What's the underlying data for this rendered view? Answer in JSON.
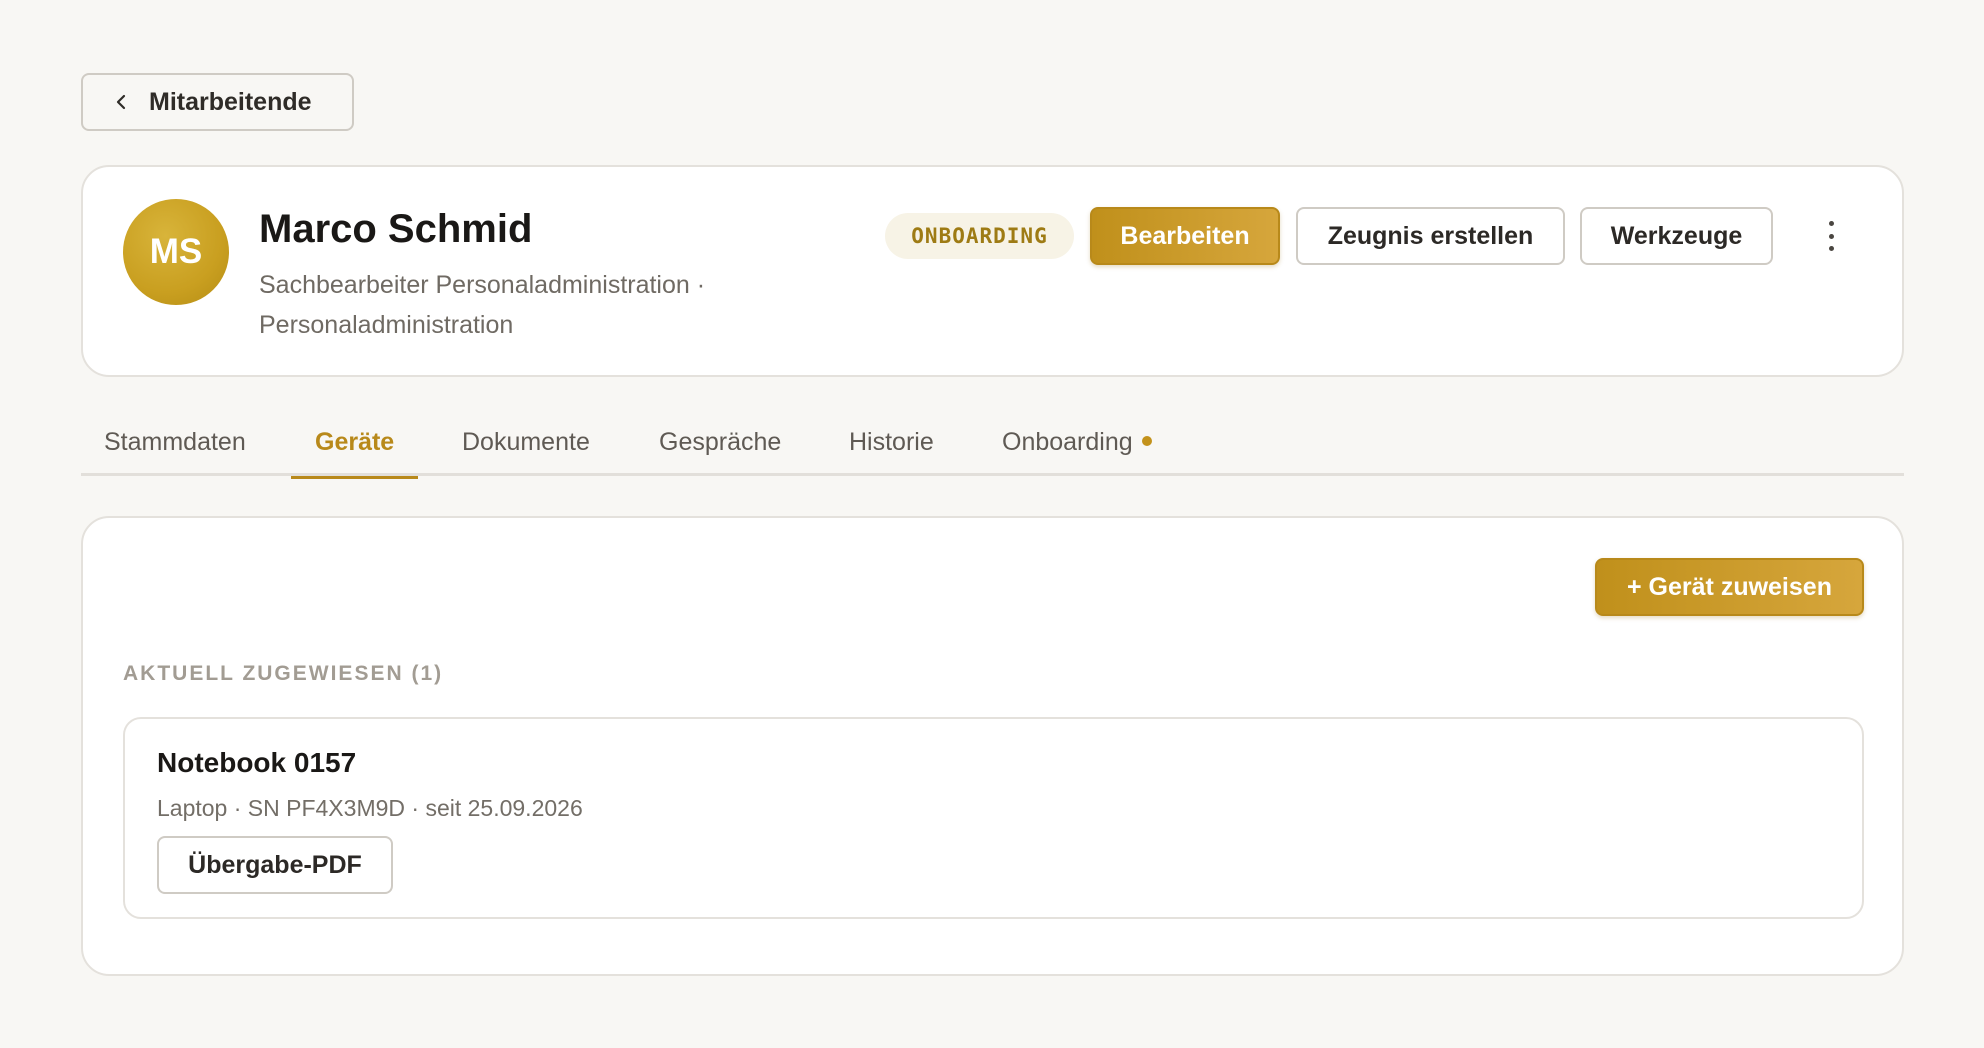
{
  "nav": {
    "back_label": "Mitarbeitende"
  },
  "employee": {
    "initials": "MS",
    "name": "Marco Schmid",
    "subtitle": "Sachbearbeiter Personaladministration · Personaladministration",
    "status_badge": "ONBOARDING"
  },
  "actions": {
    "edit": "Bearbeiten",
    "certificate": "Zeugnis erstellen",
    "tools": "Werkzeuge"
  },
  "tabs": [
    {
      "label": "Stammdaten"
    },
    {
      "label": "Geräte"
    },
    {
      "label": "Dokumente"
    },
    {
      "label": "Gespräche"
    },
    {
      "label": "Historie"
    },
    {
      "label": "Onboarding"
    }
  ],
  "active_tab": "Geräte",
  "devices": {
    "assign_button": "+ Gerät zuweisen",
    "section_label": "AKTUELL ZUGEWIESEN (1)",
    "items": [
      {
        "name": "Notebook 0157",
        "meta": "Laptop · SN PF4X3M9D · seit 25.09.2026",
        "pdf_button": "Übergabe-PDF"
      }
    ]
  },
  "colors": {
    "accent": "#b8891a",
    "background": "#f8f7f4",
    "badge_bg": "#f7f3e6"
  },
  "icons": {
    "back": "chevron-left-icon",
    "more": "more-vertical-icon",
    "tab_indicator": "dot-icon"
  }
}
